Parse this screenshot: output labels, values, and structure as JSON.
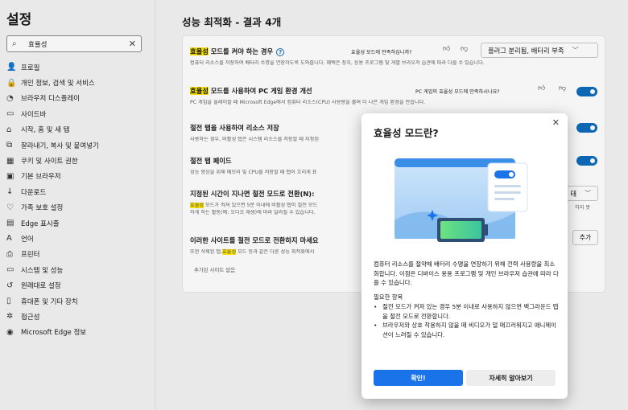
{
  "sidebar": {
    "title": "설정",
    "search": {
      "value": "효율성",
      "icon": "search-icon"
    },
    "items": [
      {
        "label": "프로필",
        "icon": "👤"
      },
      {
        "label": "개인 정보, 검색 및 서비스",
        "icon": "🔒"
      },
      {
        "label": "브라우저 디스플레이",
        "icon": "◔"
      },
      {
        "label": "사이드바",
        "icon": "▭"
      },
      {
        "label": "시작, 홈 및 새 탭",
        "icon": "⌂"
      },
      {
        "label": "잘라내기, 복사 및 붙여넣기",
        "icon": "⧉"
      },
      {
        "label": "쿠키 및 사이트 권한",
        "icon": "▦"
      },
      {
        "label": "기본 브라우저",
        "icon": "▣"
      },
      {
        "label": "다운로드",
        "icon": "↓"
      },
      {
        "label": "가족 보호 설정",
        "icon": "♡"
      },
      {
        "label": "Edge 표시줄",
        "icon": "▤"
      },
      {
        "label": "언어",
        "icon": "A"
      },
      {
        "label": "프린터",
        "icon": "⎙"
      },
      {
        "label": "시스템 및 성능",
        "icon": "▭"
      },
      {
        "label": "원래대로 설정",
        "icon": "↺"
      },
      {
        "label": "휴대폰 및 기타 장치",
        "icon": "▯"
      },
      {
        "label": "접근성",
        "icon": "✲"
      },
      {
        "label": "Microsoft Edge 정보",
        "icon": "◉"
      }
    ]
  },
  "main": {
    "title": "성능 최적화 - 결과 4개",
    "sections": {
      "efficiency": {
        "title_hl": "효율성",
        "title_rest": " 모드를 켜야 하는 경우",
        "desc": "컴퓨터 리소스를 저장하여 배터리 수명을 연장하도록 도와줍니다. 혜택은 장치, 응용 프로그램 및 개별 브라우저 습관에 따라 다를 수 있습니다.",
        "feedback": "효율성 모드에 만족하십니까?",
        "select_value": "플러그 분리됨, 배터리 부족"
      },
      "gaming": {
        "title_hl": "효율성",
        "title_rest": " 모드를 사용하여 PC 게임 환경 개선",
        "desc": "PC 게임을 플레이할 때 Microsoft Edge에서 컴퓨터 리소스(CPU) 사용량을 줄여 더 나은 게임 환경을 만듭니다.",
        "feedback": "PC 게임의 효율성 모드에 만족하시나요?"
      },
      "sleeping_tabs": {
        "title": "절전 탭을 사용하여 리소스 저장",
        "desc": "사용하는 경우, 비활성 탭은 시스템 리소스를 저장할 때 지정된"
      },
      "fade": {
        "title": "절전 탭 페이드",
        "desc": "성능 향상을 위해 메모리 및 CPU를 저장할 때 탭이 흐리게 표"
      },
      "timeout": {
        "title": "지정된 시간이 지나면 절전 모드로 전환(N):",
        "desc1_hl": "효율성",
        "desc1_rest": " 모드가 켜져 있으면 5분 이내에 비활성 탭이 절전 모드",
        "desc2": "하게 하는 활동(예: 오디오 재생)에 따라 달라질 수 있습니다.",
        "select_value": "태",
        "desc_right": "하지 못"
      },
      "never_sleep": {
        "title": "이러한 사이트를 절전 모드로 전환하지 마세요",
        "desc_pre": "또한 삭제된 탭,",
        "desc_hl": "효율성",
        "desc_rest": " 모드 등과 같은 다른 성능 최적화에서",
        "add_label": "추가",
        "empty_label": "추가된 사이트 없음"
      }
    }
  },
  "dialog": {
    "title": "효율성 모드란?",
    "body": "컴퓨터 리소스를 절약해 배터리 수명을 연장하기 위해 전력 사용량을 최소화합니다. 이점은 디바이스 용용 프로그램 및 개인 브라우저 습관에 따라 다를 수 있습니다.",
    "req_title": "필요한 항목",
    "bullets": [
      "절전 모드가 켜져 있는 경우 5분 이내로 사용하지 않으면 백그라운드 탭을 절전 모드로 전환합니다.",
      "브라우저와 상호 작용하지 않을 때 비디오가 덜 매끄러워지고 애니메이션이 느려질 수 있습니다."
    ],
    "ok_label": "확인!",
    "learn_label": "자세히 알아보기"
  },
  "colors": {
    "accent": "#0f6cbd",
    "highlight": "#ffe800",
    "primary_button": "#1a73e8"
  }
}
